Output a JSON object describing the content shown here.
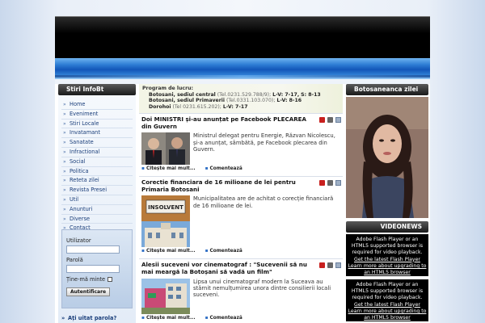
{
  "left": {
    "title": "Stiri InfoBt",
    "nav": [
      "Home",
      "Eveniment",
      "Stiri Locale",
      "Invatamant",
      "Sanatate",
      "Infractional",
      "Social",
      "Politica",
      "Reteta zilei",
      "Revista Presei",
      "Util",
      "Anunturi",
      "Diverse",
      "Contact"
    ],
    "login": {
      "user_label": "Utilizator",
      "pass_label": "Parolă",
      "remember_label": "Ține-mă minte",
      "button": "Autentificare"
    },
    "forgot": "Ați uitat parola?"
  },
  "program": {
    "title": "Program de lucru:",
    "rows": [
      {
        "name": "Botosani, sediul central",
        "tel": "(Tel.0231.529.788/9);",
        "hours": "L-V: 7-17,",
        "extra": "S: 8-13"
      },
      {
        "name": "Botosani, sediul Primaverii",
        "tel": "(Tel.0331.103.070);",
        "hours": "L-V: 8-16",
        "extra": ""
      },
      {
        "name": "Dorohoi",
        "tel": "(Tel 0231.615.202);",
        "hours": "L-V: 7-17",
        "extra": ""
      }
    ]
  },
  "articles": [
    {
      "title": "Doi MINISTRI și-au anunțat pe Facebook PLECAREA din Guvern",
      "text": "Ministrul delegat pentru Energie, Răzvan Nicolescu, și-a anunțat, sâmbătă, pe Facebook plecarea din Guvern.",
      "read_more": "Citește mai mult...",
      "comment": "Comentează"
    },
    {
      "title": "Corectie financiara de 16 milioane de lei pentru Primaria Botosani",
      "text": "Municipalitatea are de achitat o corecție financiară de 16 milioane de lei.",
      "thumb_label": "INSOLVENT",
      "read_more": "Citește mai mult...",
      "comment": "Comentează"
    },
    {
      "title": "Alesii suceveni vor cinematograf : \"Sucevenii să nu mai meargă la Botoșani să vadă un film\"",
      "text": "Lipsa unui cinematograf modern la Suceava au stârnit nemulțumirea unora dintre consilierii locali suceveni.",
      "read_more": "Citește mai mult...",
      "comment": "Comentează"
    }
  ],
  "right": {
    "photo_title": "Botosaneanca zilei",
    "video_title": "VIDEONEWS",
    "flash_lines": [
      "Adobe Flash Player or an",
      "HTML5 supported browser is",
      "required for video playback.",
      "Get the latest Flash Player",
      "Learn more about upgrading to",
      "an HTML5 browser"
    ]
  }
}
